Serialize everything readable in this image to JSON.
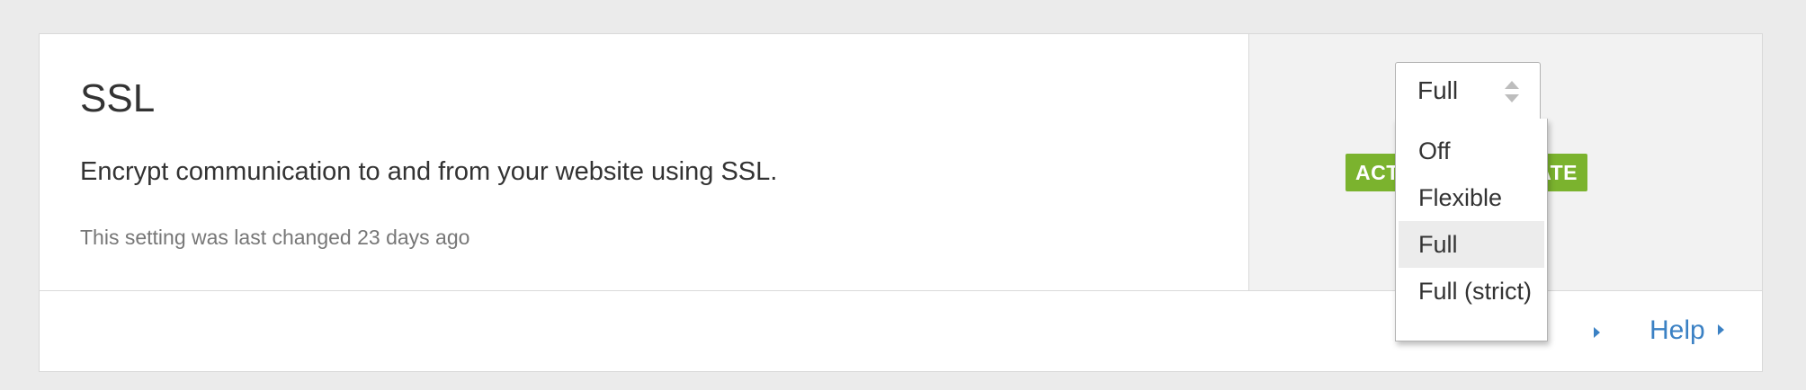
{
  "setting": {
    "title": "SSL",
    "description": "Encrypt communication to and from your website using SSL.",
    "last_changed": "This setting was last changed 23 days ago"
  },
  "status_badge": {
    "text": "ACTIVE CERTIFICATE",
    "visible_left": "ACT",
    "visible_right": "ATE",
    "color": "#7bb32e"
  },
  "ssl_select": {
    "value": "Full",
    "options": [
      "Off",
      "Flexible",
      "Full",
      "Full (strict)"
    ],
    "selected_index": 2
  },
  "footer": {
    "help_label": "Help"
  },
  "colors": {
    "accent_link": "#3b81c4",
    "page_background": "#ebebeb",
    "control_panel_background": "#f2f2f2"
  },
  "icons": {
    "select_arrows": "up-down-arrows-icon",
    "link_chevron": "chevron-right-icon"
  }
}
